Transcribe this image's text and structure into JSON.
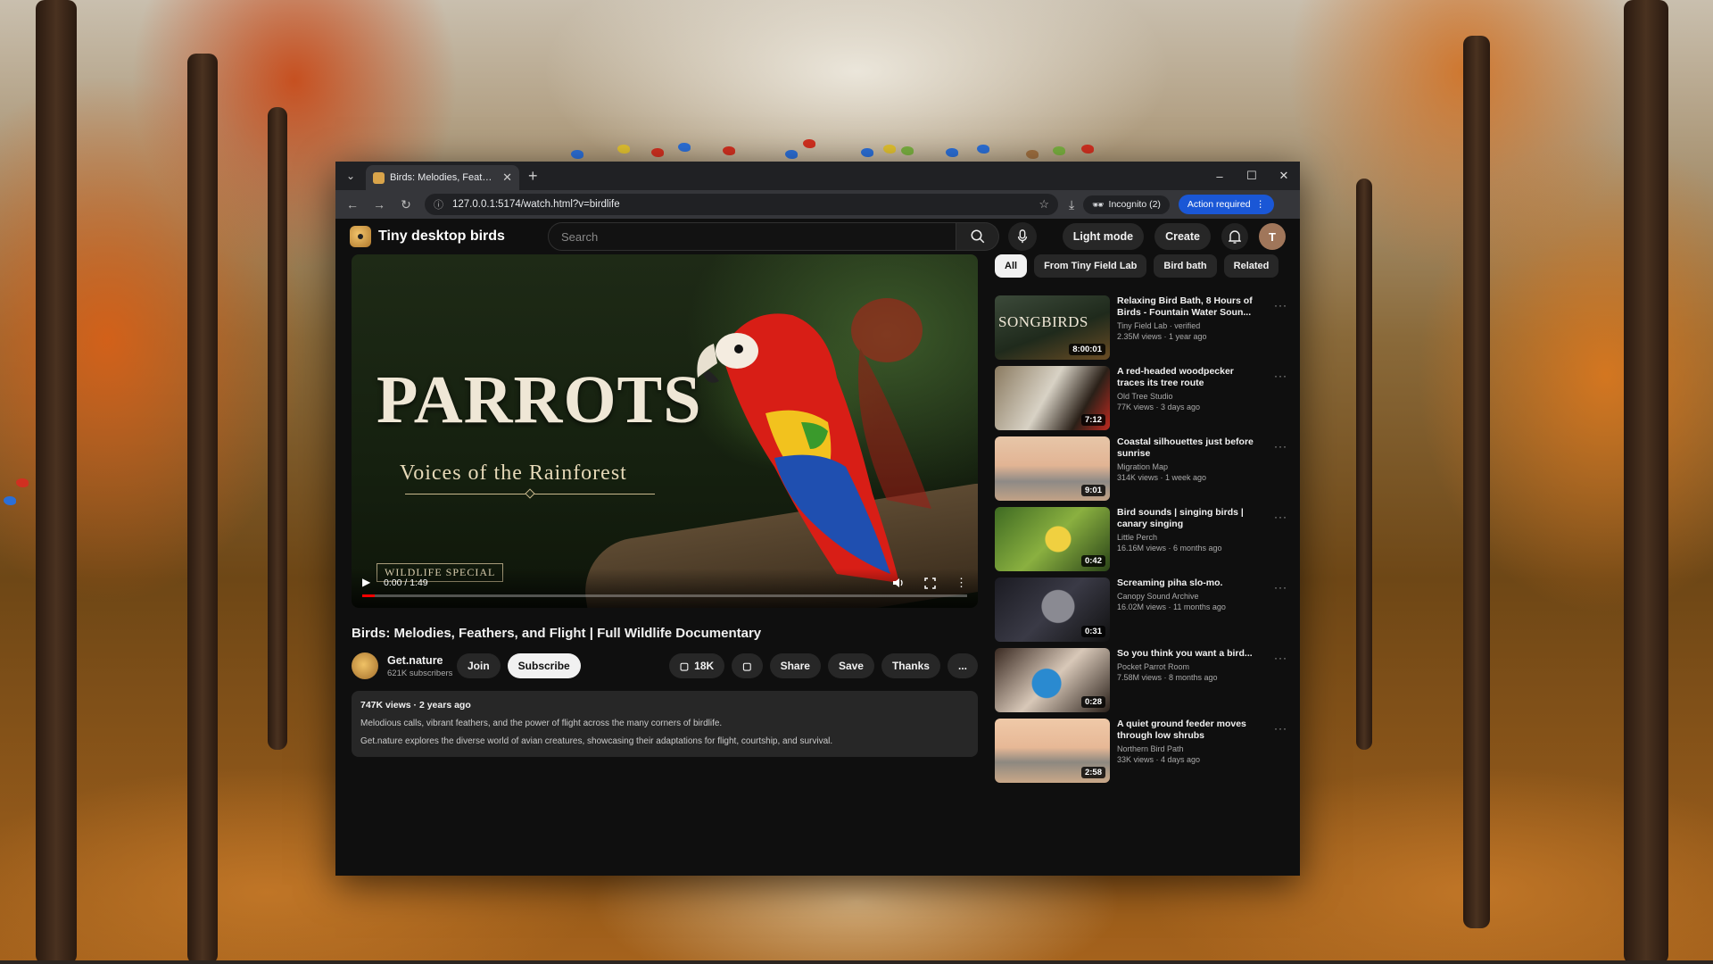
{
  "browser": {
    "tab_title": "Birds: Melodies, Feathers, and Flight | Full Wildlife Documentary",
    "url": "127.0.0.1:5174/watch.html?v=birdlife",
    "incognito_label": "Incognito (2)",
    "action_label": "Action required"
  },
  "site": {
    "name": "Tiny desktop birds",
    "search_placeholder": "Search",
    "light_mode_label": "Light mode",
    "create_label": "Create",
    "avatar_letter": "T"
  },
  "player": {
    "poster_title": "PARROTS",
    "poster_subtitle": "Voices of the Rainforest",
    "poster_badge": "WILDLIFE SPECIAL",
    "time": "0:00 / 1:49",
    "progress": 0.02
  },
  "video": {
    "title": "Birds: Melodies, Feathers, and Flight | Full Wildlife Documentary",
    "channel": "Get.nature",
    "subscribers": "621K subscribers",
    "join_label": "Join",
    "subscribe_label": "Subscribe",
    "likes": "18K",
    "share_label": "Share",
    "save_label": "Save",
    "thanks_label": "Thanks",
    "more_label": "...",
    "views_date": "747K views · 2 years ago",
    "description_1": "Melodious calls, vibrant feathers, and the power of flight across the many corners of birdlife.",
    "description_2": "Get.nature explores the diverse world of avian creatures, showcasing their adaptations for flight, courtship, and survival."
  },
  "chips": [
    "All",
    "From Tiny Field Lab",
    "Bird bath",
    "Related"
  ],
  "recommendations": [
    {
      "title": "Relaxing Bird Bath, 8 Hours of Birds - Fountain Water Soun...",
      "channel": "Tiny Field Lab · verified",
      "views": "2.35M views · 1 year ago",
      "duration": "8:00:01",
      "thumb_label": "SONGBIRDS"
    },
    {
      "title": "A red-headed woodpecker traces its tree route",
      "channel": "Old Tree Studio",
      "views": "77K views · 3 days ago",
      "duration": "7:12"
    },
    {
      "title": "Coastal silhouettes just before sunrise",
      "channel": "Migration Map",
      "views": "314K views · 1 week ago",
      "duration": "9:01"
    },
    {
      "title": "Bird sounds | singing birds | canary singing",
      "channel": "Little Perch",
      "views": "16.16M views · 6 months ago",
      "duration": "0:42"
    },
    {
      "title": "Screaming piha slo-mo.",
      "channel": "Canopy Sound Archive",
      "views": "16.02M views · 11 months ago",
      "duration": "0:31"
    },
    {
      "title": "So you think you want a bird...",
      "channel": "Pocket Parrot Room",
      "views": "7.58M views · 8 months ago",
      "duration": "0:28"
    },
    {
      "title": "A quiet ground feeder moves through low shrubs",
      "channel": "Northern Bird Path",
      "views": "33K views · 4 days ago",
      "duration": "2:58"
    }
  ]
}
